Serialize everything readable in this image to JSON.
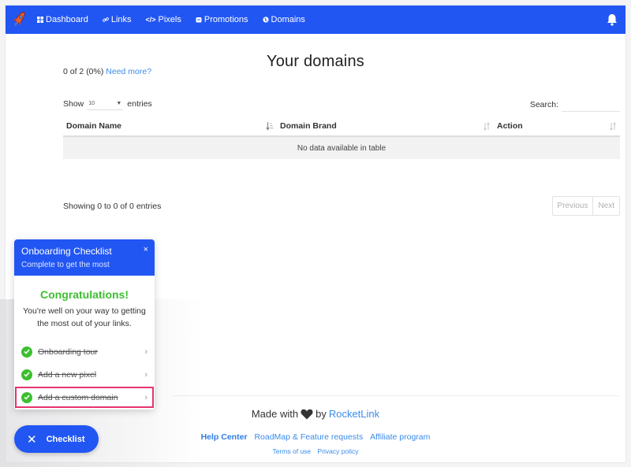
{
  "nav": {
    "brand_icon": "rocket-icon",
    "items": [
      {
        "label": "Dashboard",
        "icon": "grid-icon"
      },
      {
        "label": "Links",
        "icon": "link-icon"
      },
      {
        "label": "Pixels",
        "icon": "code-icon"
      },
      {
        "label": "Promotions",
        "icon": "promotion-icon"
      },
      {
        "label": "Domains",
        "icon": "globe-icon"
      }
    ],
    "notification_icon": "bell-icon"
  },
  "main": {
    "title": "Your domains",
    "usage_text": "0 of 2 (0%)",
    "usage_link": "Need more?",
    "show_label": "Show",
    "entries_label": "entries",
    "page_length": "10",
    "search_label": "Search:",
    "search_value": "",
    "table": {
      "columns": [
        "Domain Name",
        "Domain Brand",
        "Action"
      ],
      "rows": [],
      "empty_message": "No data available in table"
    },
    "info": "Showing 0 to 0 of 0 entries",
    "pagination": {
      "previous": "Previous",
      "next": "Next"
    }
  },
  "footer": {
    "made_with": "Made with",
    "by": "by",
    "brand_link": "RocketLink",
    "links": [
      "Help Center",
      "RoadMap & Feature requests",
      "Affiliate program"
    ],
    "legal_links": [
      "Terms of use",
      "Privacy policy"
    ]
  },
  "checklist": {
    "title": "Onboarding Checklist",
    "subtitle": "Complete to get the most",
    "close": "×",
    "congrats_title": "Congratulations!",
    "congrats_message": "You're well on your way to getting the most out of your links.",
    "tasks": [
      {
        "label": "Onboarding tour",
        "done": true
      },
      {
        "label": "Add a new pixel",
        "done": true
      },
      {
        "label": "Add a custom domain",
        "done": true,
        "highlighted": true
      }
    ],
    "toggle_button": "Checklist"
  },
  "colors": {
    "primary": "#2156f3",
    "success": "#3cbf2f",
    "link": "#3b8bea",
    "highlight": "#e6336f"
  }
}
